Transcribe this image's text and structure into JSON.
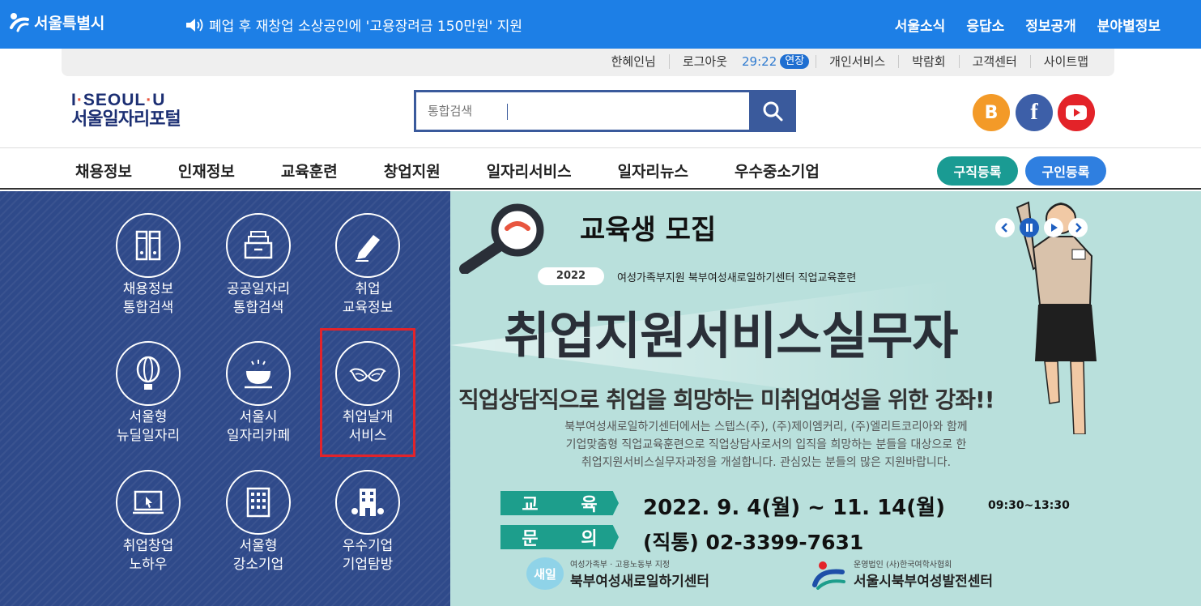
{
  "topbar": {
    "logo": "서울특별시",
    "notice": "폐업 후 재창업 소상공인에 '고용장려금 150만원' 지원",
    "nav": [
      "서울소식",
      "응답소",
      "정보공개",
      "분야별정보"
    ]
  },
  "utility": {
    "user": "한혜인님",
    "logout": "로그아웃",
    "timer": "29:22",
    "extend": "연장",
    "links": [
      "개인서비스",
      "박람회",
      "고객센터",
      "사이트맵"
    ]
  },
  "header": {
    "logo_line1_a": "I",
    "logo_line1_b": "SEOUL",
    "logo_line1_c": "U",
    "logo_line2": "서울일자리포털",
    "search_placeholder": "통합검색",
    "sns": {
      "blog": "B",
      "facebook": "f"
    }
  },
  "mainnav": {
    "items": [
      "채용정보",
      "인재정보",
      "교육훈련",
      "창업지원",
      "일자리서비스",
      "일자리뉴스",
      "우수중소기업"
    ],
    "job_register": "구직등록",
    "hire_register": "구인등록"
  },
  "tiles": [
    {
      "icon": "binder-icon",
      "l1": "채용정보",
      "l2": "통합검색"
    },
    {
      "icon": "file-box-icon",
      "l1": "공공일자리",
      "l2": "통합검색"
    },
    {
      "icon": "pen-icon",
      "l1": "취업",
      "l2": "교육정보"
    },
    {
      "icon": "balloon-icon",
      "l1": "서울형",
      "l2": "뉴딜일자리"
    },
    {
      "icon": "cafe-cup-icon",
      "l1": "서울시",
      "l2": "일자리카페"
    },
    {
      "icon": "wings-icon",
      "l1": "취업날개",
      "l2": "서비스"
    },
    {
      "icon": "computer-cursor-icon",
      "l1": "취업창업",
      "l2": "노하우"
    },
    {
      "icon": "building-icon",
      "l1": "서울형",
      "l2": "강소기업"
    },
    {
      "icon": "company-building-icon",
      "l1": "우수기업",
      "l2": "기업탐방"
    }
  ],
  "banner": {
    "title": "교육생 모집",
    "year": "2022",
    "subtitle": "여성가족부지원 북부여성새로일하기센터 직업교육훈련",
    "main": "취업지원서비스실무자",
    "desc": "직업상담직으로 취업을 희망하는 미취업여성을 위한 강좌!!",
    "body": [
      "북부여성새로일하기센터에서는 스텝스(주), (주)제이엠커리, (주)엘리트코리아와 함께",
      "기업맞춤형 직업교육훈련으로 직업상담사로서의 입직을 희망하는 분들을 대상으로 한",
      "취업지원서비스실무자과정을 개설합니다. 관심있는 분들의 많은 지원바랍니다."
    ],
    "tag1": [
      "교",
      "육"
    ],
    "date": "2022. 9. 4(월) ~ 11. 14(월)",
    "time": "09:30~13:30",
    "tag2": [
      "문",
      "의"
    ],
    "phone": "(직통) 02-3399-7631",
    "org1_logo": "새일",
    "org1_small": "여성가족부 · 고용노동부 지정",
    "org1_big": "북부여성새로일하기센터",
    "org2_small": "운영법인 (사)한국여학사협회",
    "org2_big": "서울시북부여성발전센터"
  },
  "colors": {
    "topbar": "#1d7fe6",
    "panel": "#2f4a8a",
    "banner": "#b9e0dc",
    "highlight": "#e2232a"
  }
}
